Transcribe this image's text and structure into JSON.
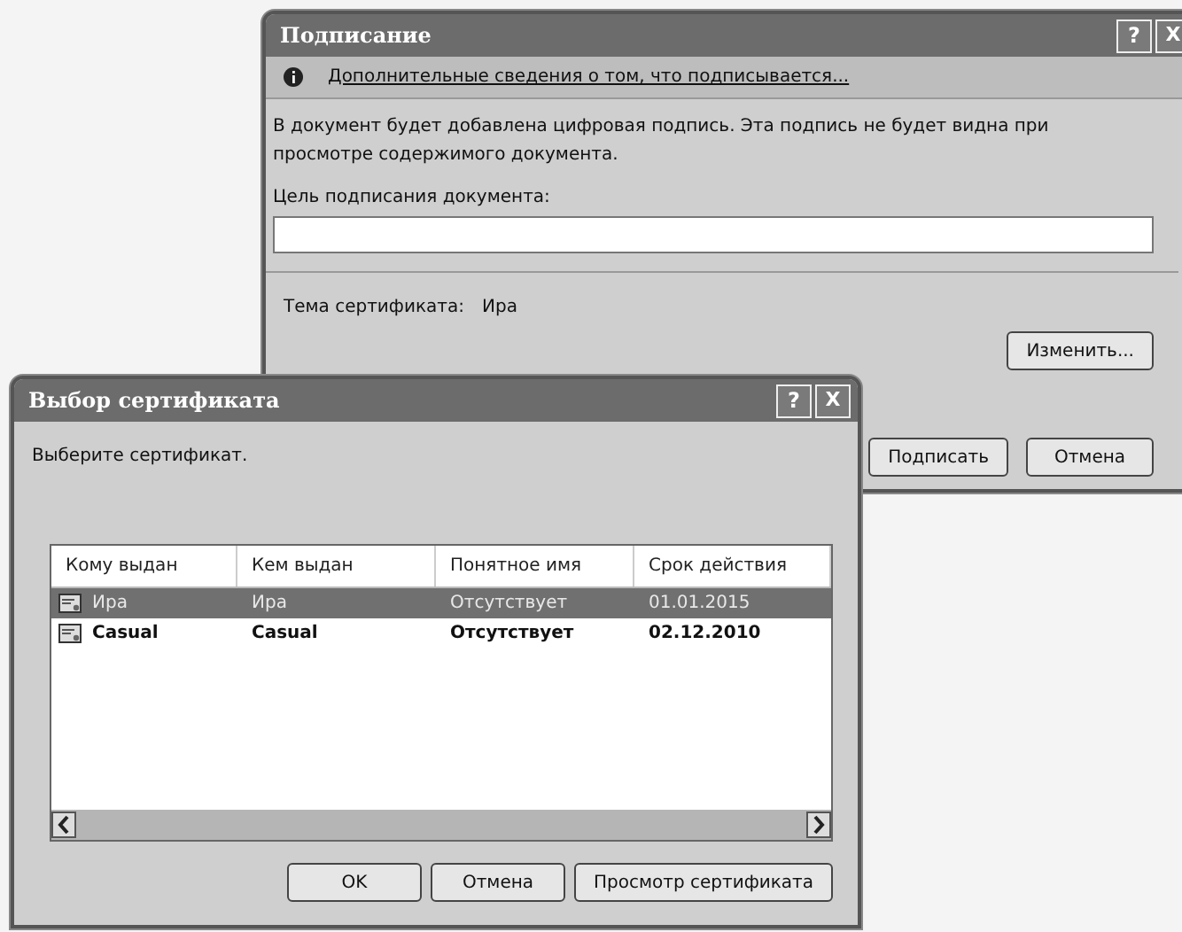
{
  "signing_dialog": {
    "title": "Подписание",
    "title_buttons": [
      "?",
      "X"
    ],
    "info_link": "Дополнительные сведения о том, что подписывается...",
    "message": "В документ будет добавлена цифровая подпись. Эта подпись не будет видна при просмотре содержимого документа.",
    "purpose_label": "Цель подписания документа:",
    "certificate_label": "Тема сертификата:",
    "certificate_value": "Ира",
    "change_button": "Изменить...",
    "buttons": [
      "Подписать",
      "Отмена"
    ]
  },
  "certificate_dialog": {
    "title": "Выбор сертификата",
    "title_buttons": [
      "?",
      "X"
    ],
    "prompt": "Выберите сертификат.",
    "columns": [
      "Кому выдан",
      "Кем выдан",
      "Понятное имя",
      "Срок действия"
    ],
    "rows": [
      {
        "cells": [
          "Ира",
          "Ира",
          "Отсутствует",
          "01.01.2015"
        ],
        "selected": true
      },
      {
        "cells": [
          "Casual",
          "Casual",
          "Отсутствует",
          "02.12.2010"
        ],
        "selected": false
      }
    ],
    "buttons": [
      "OK",
      "Отмена",
      "Просмотр сертификата"
    ]
  }
}
